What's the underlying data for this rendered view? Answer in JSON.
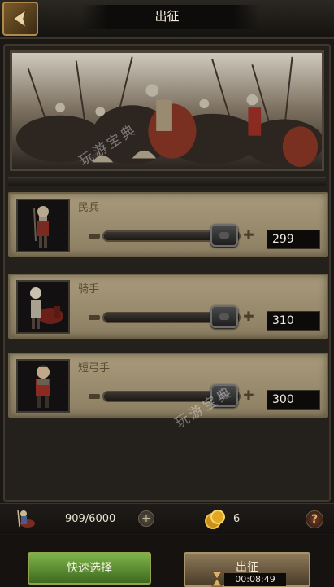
{
  "header": {
    "title": "出征"
  },
  "units": [
    {
      "name": "民兵",
      "value": "299",
      "fill": 0.87
    },
    {
      "name": "骑手",
      "value": "310",
      "fill": 0.87
    },
    {
      "name": "短弓手",
      "value": "300",
      "fill": 0.87
    }
  ],
  "stats": {
    "troops": "909/6000",
    "coins": "6"
  },
  "buttons": {
    "quick_select": "快速选择",
    "march": "出征",
    "march_timer": "00:08:49"
  },
  "watermark": "玩游宝典",
  "icons": {
    "back": "back-arrow-icon",
    "troop": "cavalry-icon",
    "add": "plus-icon",
    "coin": "gold-coin-icon",
    "help": "question-icon",
    "timer": "hourglass-icon"
  },
  "colors": {
    "accent_green": "#5a8a30",
    "panel_tan": "#9c8e70",
    "frame_dark": "#24211d"
  }
}
